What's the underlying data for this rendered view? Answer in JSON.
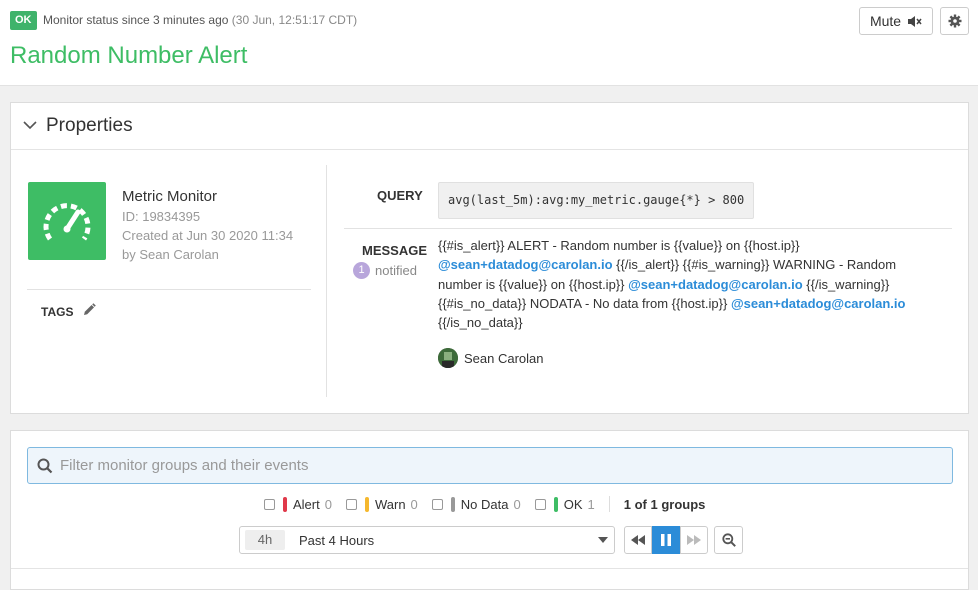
{
  "header": {
    "status_badge": "OK",
    "status_text": "Monitor status since 3 minutes ago",
    "status_time": "(30 Jun, 12:51:17 CDT)",
    "title": "Random Number Alert",
    "mute_label": "Mute",
    "mute_icon": "speaker-muted-icon",
    "settings_icon": "gear-icon"
  },
  "properties": {
    "title": "Properties",
    "monitor_type": "Metric Monitor",
    "monitor_id": "ID: 19834395",
    "created_at": "Created at Jun 30 2020 11:34",
    "created_by": "by Sean Carolan",
    "tags_label": "TAGS",
    "query_label": "QUERY",
    "query": "avg(last_5m):avg:my_metric.gauge{*} > 800",
    "message_label": "MESSAGE",
    "notified_count": "1",
    "notified_label": "notified",
    "message": {
      "p1": "{{#is_alert}} ALERT - Random number is {{value}} on {{host.ip}}",
      "mention1": "@sean+datadog@carolan.io",
      "p2": " {{/is_alert}} {{#is_warning}} WARNING - Random number is {{value}} on {{host.ip}} ",
      "mention2": "@sean+datadog@carolan.io",
      "p3": " {{/is_warning}} {{#is_no_data}} NODATA - No data from {{host.ip}} ",
      "mention3": "@sean+datadog@carolan.io",
      "p4": " {{/is_no_data}}"
    },
    "notified_user": "Sean Carolan"
  },
  "groups": {
    "filter_placeholder": "Filter monitor groups and their events",
    "legend": [
      {
        "label": "Alert",
        "count": "0",
        "color": "#e0394a"
      },
      {
        "label": "Warn",
        "count": "0",
        "color": "#f5b82e"
      },
      {
        "label": "No Data",
        "count": "0",
        "color": "#999999"
      },
      {
        "label": "OK",
        "count": "1",
        "color": "#3ebd65"
      }
    ],
    "group_count": "1 of 1 groups",
    "timeframe_badge": "4h",
    "timeframe_label": "Past 4 Hours"
  },
  "colors": {
    "ok_green": "#3ebd65",
    "link_blue": "#2b8cd8"
  }
}
